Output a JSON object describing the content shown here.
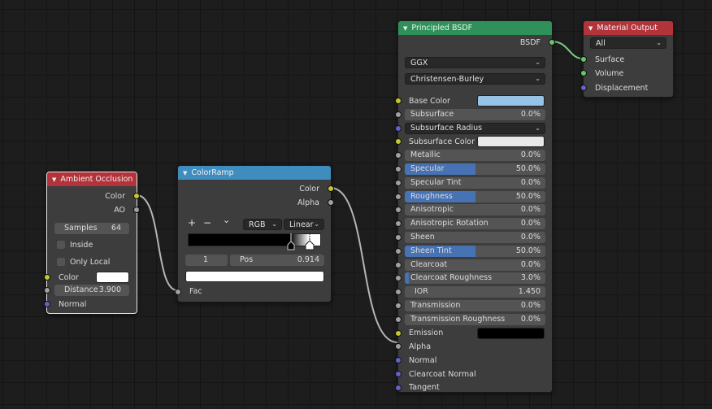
{
  "nodes": {
    "ao": {
      "title": "Ambient Occlusion",
      "outputs": [
        "Color",
        "AO"
      ],
      "samples": {
        "label": "Samples",
        "value": "64"
      },
      "inside": "Inside",
      "only_local": "Only Local",
      "color_label": "Color",
      "color_value": "#ffffff",
      "distance": {
        "label": "Distance",
        "value": "3.900"
      },
      "normal": "Normal",
      "header_color": "#b3333b"
    },
    "ramp": {
      "title": "ColorRamp",
      "outputs": [
        "Color",
        "Alpha"
      ],
      "plus": "+",
      "minus": "−",
      "chevron": "⌄",
      "color_mode": "RGB",
      "interpolation": "Linear",
      "index": "1",
      "pos": {
        "label": "Pos",
        "value": "0.914"
      },
      "fac": "Fac",
      "stop_color": "#ffffff",
      "stops": [
        {
          "position": 0.773,
          "color": "#000000"
        },
        {
          "position": 0.914,
          "color": "#ffffff"
        }
      ],
      "header_color": "#3f8dbf"
    },
    "bsdf": {
      "title": "Principled BSDF",
      "output": "BSDF",
      "distribution": "GGX",
      "subsurface_method": "Christensen-Burley",
      "header_color": "#2f9159",
      "rows": [
        {
          "type": "color",
          "label": "Base Color",
          "socket": "yellow",
          "color": "#97c4e6"
        },
        {
          "type": "value",
          "label": "Subsurface",
          "value": "0.0%",
          "fill": 0,
          "socket": "grey"
        },
        {
          "type": "dropdown",
          "label": "Subsurface Radius",
          "socket": "blue"
        },
        {
          "type": "color",
          "label": "Subsurface Color",
          "socket": "yellow",
          "color": "#e8e8e8"
        },
        {
          "type": "value",
          "label": "Metallic",
          "value": "0.0%",
          "fill": 0,
          "socket": "grey"
        },
        {
          "type": "value",
          "label": "Specular",
          "value": "50.0%",
          "fill": 0.5,
          "socket": "grey"
        },
        {
          "type": "value",
          "label": "Specular Tint",
          "value": "0.0%",
          "fill": 0,
          "socket": "grey"
        },
        {
          "type": "value",
          "label": "Roughness",
          "value": "50.0%",
          "fill": 0.5,
          "socket": "grey"
        },
        {
          "type": "value",
          "label": "Anisotropic",
          "value": "0.0%",
          "fill": 0,
          "socket": "grey"
        },
        {
          "type": "value",
          "label": "Anisotropic Rotation",
          "value": "0.0%",
          "fill": 0,
          "socket": "grey"
        },
        {
          "type": "value",
          "label": "Sheen",
          "value": "0.0%",
          "fill": 0,
          "socket": "grey"
        },
        {
          "type": "value",
          "label": "Sheen Tint",
          "value": "50.0%",
          "fill": 0.5,
          "socket": "grey"
        },
        {
          "type": "value",
          "label": "Clearcoat",
          "value": "0.0%",
          "fill": 0,
          "socket": "grey"
        },
        {
          "type": "value",
          "label": "Clearcoat Roughness",
          "value": "3.0%",
          "fill": 0.03,
          "socket": "grey"
        },
        {
          "type": "value",
          "label": "IOR",
          "value": "1.450",
          "fill": 0,
          "socket": "grey"
        },
        {
          "type": "value",
          "label": "Transmission",
          "value": "0.0%",
          "fill": 0,
          "socket": "grey"
        },
        {
          "type": "value",
          "label": "Transmission Roughness",
          "value": "0.0%",
          "fill": 0,
          "socket": "grey"
        },
        {
          "type": "color",
          "label": "Emission",
          "socket": "yellow",
          "color": "#000000"
        },
        {
          "type": "label",
          "label": "Alpha",
          "socket": "grey"
        },
        {
          "type": "label",
          "label": "Normal",
          "socket": "blue"
        },
        {
          "type": "label",
          "label": "Clearcoat Normal",
          "socket": "blue"
        },
        {
          "type": "label",
          "label": "Tangent",
          "socket": "blue"
        }
      ]
    },
    "output": {
      "title": "Material Output",
      "target": "All",
      "inputs": [
        "Surface",
        "Volume",
        "Displacement"
      ],
      "header_color": "#b3333b"
    }
  },
  "icons": {
    "collapse": "triangle-down-icon"
  }
}
